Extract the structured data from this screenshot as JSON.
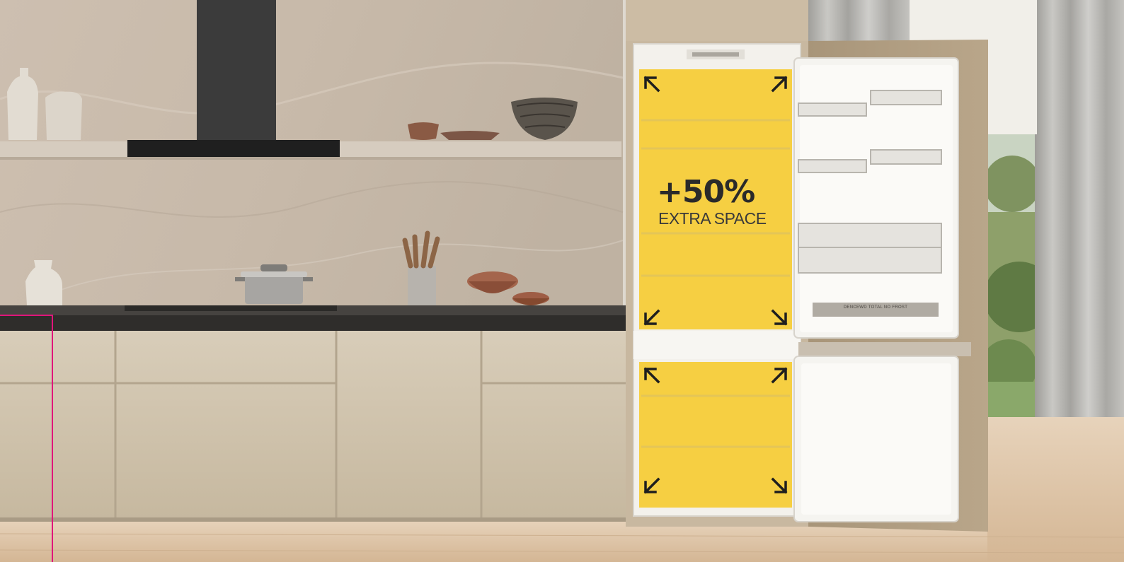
{
  "promo": {
    "headline": "+50%",
    "subline": "EXTRA SPACE"
  },
  "appliance": {
    "shelf_label": "DENCEWD TOTAL NO FROST"
  },
  "colors": {
    "highlight": "#f6c200",
    "accent_line": "#e0157a",
    "cabinet": "#cfc3ad",
    "countertop": "#3f3d3b",
    "wall": "#cbbfb0",
    "door_panel": "#a9977d",
    "floor": "#dcc2a3"
  },
  "icons": [
    "expand-arrow-icon"
  ]
}
